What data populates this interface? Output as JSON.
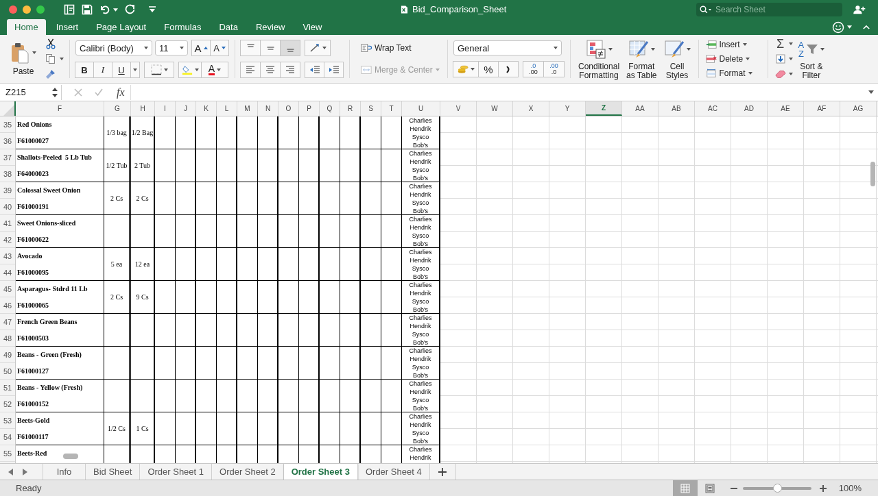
{
  "window": {
    "title": "Bid_Comparison_Sheet"
  },
  "search": {
    "placeholder": "Search Sheet"
  },
  "ribbon_tabs": [
    {
      "label": "Home",
      "selected": true
    },
    {
      "label": "Insert",
      "selected": false
    },
    {
      "label": "Page Layout",
      "selected": false
    },
    {
      "label": "Formulas",
      "selected": false
    },
    {
      "label": "Data",
      "selected": false
    },
    {
      "label": "Review",
      "selected": false
    },
    {
      "label": "View",
      "selected": false
    }
  ],
  "clipboard": {
    "paste": "Paste"
  },
  "font": {
    "name": "Calibri (Body)",
    "size": "11",
    "grow": "A",
    "shrink": "A",
    "bold": "B",
    "italic": "I",
    "underline": "U",
    "color_glyph": "A"
  },
  "alignment": {
    "vertical": [
      {
        "kind": "top",
        "selected": false
      },
      {
        "kind": "middle",
        "selected": false
      },
      {
        "kind": "bottom",
        "selected": true
      }
    ],
    "wrap_text": "Wrap Text",
    "merge": {
      "label": "Merge & Center",
      "disabled": true
    }
  },
  "number": {
    "format": "General",
    "percent": "%",
    "increase_decimal": [
      ".0",
      ".00"
    ],
    "decrease_decimal": [
      ".00",
      ".0"
    ]
  },
  "styles": [
    {
      "kind": "conditional",
      "label": "Conditional\nFormatting"
    },
    {
      "kind": "table",
      "label": "Format\nas Table"
    },
    {
      "kind": "cell",
      "label": "Cell\nStyles"
    }
  ],
  "cells": [
    {
      "kind": "insert",
      "label": "Insert"
    },
    {
      "kind": "delete",
      "label": "Delete"
    },
    {
      "kind": "format",
      "label": "Format"
    }
  ],
  "editing": {
    "sum": "Σ",
    "sort_letters": [
      "A",
      "Z"
    ],
    "sort_filter": "Sort &\nFilter"
  },
  "formula_bar": {
    "name_box": "Z215",
    "function": "fx"
  },
  "columns": [
    {
      "label": "F",
      "selected": false
    },
    {
      "label": "G",
      "selected": false
    },
    {
      "label": "H",
      "selected": false
    },
    {
      "label": "I",
      "selected": false
    },
    {
      "label": "J",
      "selected": false
    },
    {
      "label": "K",
      "selected": false
    },
    {
      "label": "L",
      "selected": false
    },
    {
      "label": "M",
      "selected": false
    },
    {
      "label": "N",
      "selected": false
    },
    {
      "label": "O",
      "selected": false
    },
    {
      "label": "P",
      "selected": false
    },
    {
      "label": "Q",
      "selected": false
    },
    {
      "label": "R",
      "selected": false
    },
    {
      "label": "S",
      "selected": false
    },
    {
      "label": "T",
      "selected": false
    },
    {
      "label": "U",
      "selected": false
    },
    {
      "label": "V",
      "selected": false
    },
    {
      "label": "W",
      "selected": false
    },
    {
      "label": "X",
      "selected": false
    },
    {
      "label": "Y",
      "selected": false
    },
    {
      "label": "Z",
      "selected": true
    },
    {
      "label": "AA",
      "selected": false
    },
    {
      "label": "AB",
      "selected": false
    },
    {
      "label": "AC",
      "selected": false
    },
    {
      "label": "AD",
      "selected": false
    },
    {
      "label": "AE",
      "selected": false
    },
    {
      "label": "AF",
      "selected": false
    },
    {
      "label": "AG",
      "selected": false
    }
  ],
  "rows": [
    {
      "numbers": [
        "35",
        "36"
      ],
      "name": "Red Onions",
      "code": "F61000027",
      "col_g": "1/3 bag",
      "col_h": "1/2 Bag",
      "col_u": [
        "Charlies",
        "Hendrik",
        "Sysco",
        "Bob's"
      ]
    },
    {
      "numbers": [
        "37",
        "38"
      ],
      "name": "Shallots-Peeled  5 Lb Tub",
      "code": "F64000023",
      "col_g": "1/2 Tub",
      "col_h": "2 Tub",
      "col_u": [
        "Charlies",
        "Hendrik",
        "Sysco",
        "Bob's"
      ]
    },
    {
      "numbers": [
        "39",
        "40"
      ],
      "name": "Colossal Sweet Onion",
      "code": "F61000191",
      "col_g": "2 Cs",
      "col_h": "2 Cs",
      "col_u": [
        "Charlies",
        "Hendrik",
        "Sysco",
        "Bob's"
      ]
    },
    {
      "numbers": [
        "41",
        "42"
      ],
      "name": "Sweet Onions-sliced",
      "code": "F61000622",
      "col_u": [
        "Charlies",
        "Hendrik",
        "Sysco",
        "Bob's"
      ]
    },
    {
      "numbers": [
        "43",
        "44"
      ],
      "name": "Avocado",
      "code": "F61000095",
      "col_g": "5 ea",
      "col_h": "12 ea",
      "col_u": [
        "Charlies",
        "Hendrik",
        "Sysco",
        "Bob's"
      ]
    },
    {
      "numbers": [
        "45",
        "46"
      ],
      "name": "Asparagus- Stdrd 11 Lb",
      "code": "F61000065",
      "col_g": "2 Cs",
      "col_h": "9 Cs",
      "col_u": [
        "Charlies",
        "Hendrik",
        "Sysco",
        "Bob's"
      ]
    },
    {
      "numbers": [
        "47",
        "48"
      ],
      "name": "French Green Beans",
      "code": "F61000503",
      "col_u": [
        "Charlies",
        "Hendrik",
        "Sysco",
        "Bob's"
      ]
    },
    {
      "numbers": [
        "49",
        "50"
      ],
      "name": "Beans - Green (Fresh)",
      "code": "F61000127",
      "col_u": [
        "Charlies",
        "Hendrik",
        "Sysco",
        "Bob's"
      ]
    },
    {
      "numbers": [
        "51",
        "52"
      ],
      "name": "Beans - Yellow (Fresh)",
      "code": "F61000152",
      "col_u": [
        "Charlies",
        "Hendrik",
        "Sysco",
        "Bob's"
      ]
    },
    {
      "numbers": [
        "53",
        "54"
      ],
      "name": "Beets-Gold",
      "code": "F61000117",
      "col_g": "1/2 Cs",
      "col_h": "1 Cs",
      "col_u": [
        "Charlies",
        "Hendrik",
        "Sysco",
        "Bob's"
      ]
    },
    {
      "numbers": [
        "55"
      ],
      "name": "Beets-Red",
      "col_u": [
        "Charlies",
        "Hendrik"
      ]
    }
  ],
  "sheet_tabs": [
    {
      "label": "Info",
      "selected": false
    },
    {
      "label": "Bid Sheet",
      "selected": false
    },
    {
      "label": "Order Sheet 1",
      "selected": false
    },
    {
      "label": "Order Sheet 2",
      "selected": false
    },
    {
      "label": "Order Sheet 3",
      "selected": true
    },
    {
      "label": "Order Sheet 4",
      "selected": false
    }
  ],
  "status_bar": {
    "status": "Ready",
    "views": [
      {
        "kind": "normal",
        "selected": true
      },
      {
        "kind": "page_layout",
        "selected": false
      }
    ],
    "zoom": {
      "level": 0.5,
      "reading": "100%"
    }
  }
}
